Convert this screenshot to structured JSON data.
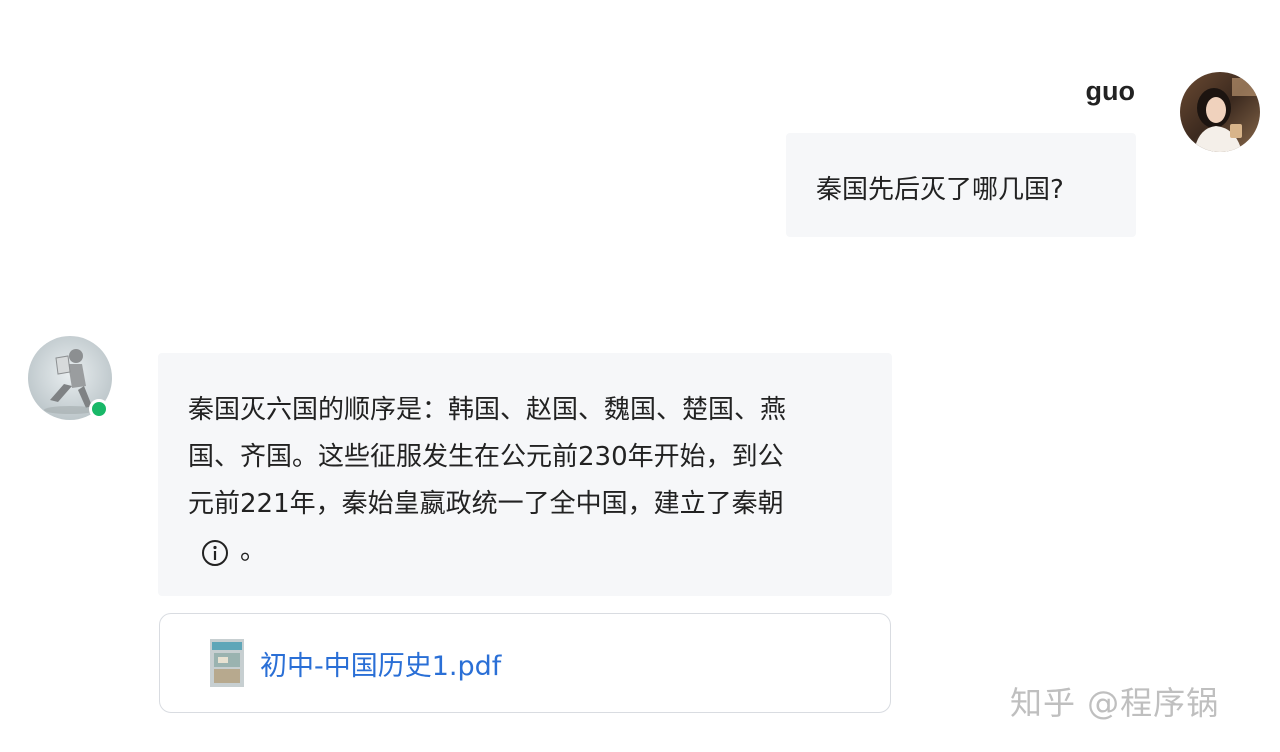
{
  "user_message": {
    "name": "guo",
    "text": "秦国先后灭了哪几国?"
  },
  "assistant_message": {
    "lines": [
      "秦国灭六国的顺序是：韩国、赵国、魏国、楚国、燕",
      "国、齐国。这些征服发生在公元前230年开始，到公",
      "元前221年，秦始皇嬴政统一了全中国，建立了秦朝"
    ],
    "trailing_punct": "。",
    "status": "online",
    "status_color": "#19b868"
  },
  "attachment": {
    "file_name": "初中-中国历史1.pdf",
    "link_color": "#2a6fd6"
  },
  "icons": {
    "user_avatar": "user-avatar-photo",
    "bot_avatar": "bot-avatar-figure",
    "citation": "info-circle-icon",
    "file": "pdf-thumbnail-icon"
  },
  "watermark": "知乎 @程序锅"
}
